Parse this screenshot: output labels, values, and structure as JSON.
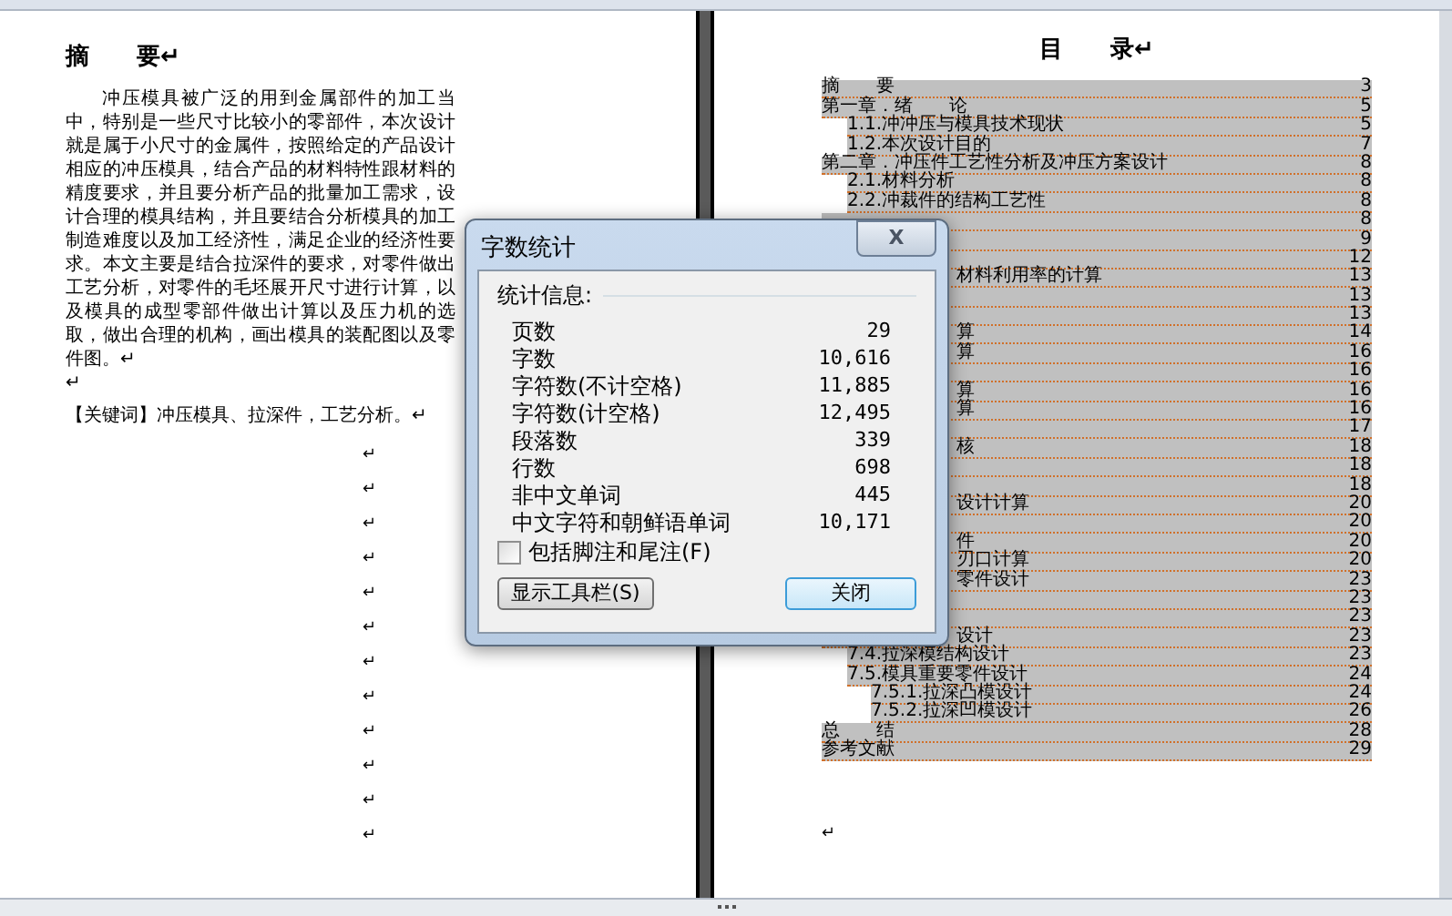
{
  "left_page": {
    "heading": "摘　　要↵",
    "abstract": "冲压模具被广泛的用到金属部件的加工当中，特别是一些尺寸比较小的零部件，本次设计就是属于小尺寸的金属件，按照给定的产品设计相应的冲压模具，结合产品的材料特性跟材料的精度要求，并且要分析产品的批量加工需求，设计合理的模具结构，并且要结合分析模具的加工制造难度以及加工经济性，满足企业的经济性要求。本文主要是结合拉深件的要求，对零件做出工艺分析，对零件的毛坯展开尺寸进行计算，以及模具的成型零部件做出计算以及压力机的选取，做出合理的机构，画出模具的装配图以及零件图。↵",
    "blank_mark": "↵",
    "keywords": "【关键词】冲压模具、拉深件，工艺分析。↵",
    "empty_paragraphs": [
      "↵",
      "↵",
      "↵",
      "↵",
      "↵",
      "↵",
      "↵",
      "↵",
      "↵",
      "↵",
      "↵",
      "↵"
    ]
  },
  "right_page": {
    "heading": "目　　录↵",
    "toc": [
      {
        "kind": "heading",
        "text": "摘　　要",
        "page": "3"
      },
      {
        "kind": "heading",
        "text": "第一章．绪　　论",
        "page": "5"
      },
      {
        "kind": "section",
        "text": "1.1.冲冲压与模具技术现状",
        "page": "5"
      },
      {
        "kind": "section",
        "text": "1.2.本次设计目的",
        "page": "7"
      },
      {
        "kind": "heading",
        "text": "第二章．冲压件工艺性分析及冲压方案设计",
        "page": "8"
      },
      {
        "kind": "section",
        "text": "2.1.材料分析",
        "page": "8"
      },
      {
        "kind": "section",
        "text": "2.2.冲裁件的结构工艺性",
        "page": "8"
      },
      {
        "kind": "clipped",
        "page": "8"
      },
      {
        "kind": "clipped",
        "page": "9"
      },
      {
        "kind": "clipped",
        "page": "12"
      },
      {
        "kind": "clipped",
        "text": "材料利用率的计算",
        "page": "13"
      },
      {
        "kind": "clipped",
        "page": "13"
      },
      {
        "kind": "clipped",
        "page": "13"
      },
      {
        "kind": "clipped",
        "text": "算",
        "page": "14"
      },
      {
        "kind": "clipped",
        "text": "算",
        "page": "16"
      },
      {
        "kind": "clipped",
        "page": "16"
      },
      {
        "kind": "clipped",
        "text": "算",
        "page": "16"
      },
      {
        "kind": "clipped",
        "text": "算",
        "page": "16"
      },
      {
        "kind": "clipped",
        "page": "17"
      },
      {
        "kind": "clipped",
        "text": "核",
        "page": "18"
      },
      {
        "kind": "clipped",
        "page": "18"
      },
      {
        "kind": "clipped",
        "page": "18"
      },
      {
        "kind": "clipped",
        "text": "设计计算",
        "page": "20"
      },
      {
        "kind": "clipped",
        "page": "20"
      },
      {
        "kind": "clipped",
        "text": "件",
        "page": "20"
      },
      {
        "kind": "clipped",
        "text": "刃口计算",
        "page": "20"
      },
      {
        "kind": "clipped",
        "text": "零件设计",
        "page": "23"
      },
      {
        "kind": "clipped",
        "page": "23"
      },
      {
        "kind": "clipped",
        "page": "23"
      },
      {
        "kind": "clipped",
        "text": "设计",
        "page": "23"
      },
      {
        "kind": "section",
        "text": "7.4.拉深模结构设计",
        "page": "23"
      },
      {
        "kind": "section",
        "text": "7.5.模具重要零件设计",
        "page": "24"
      },
      {
        "kind": "subsection",
        "text": "7.5.1.拉深凸模设计",
        "page": "24"
      },
      {
        "kind": "subsection",
        "text": "7.5.2.拉深凹模设计",
        "page": "26"
      },
      {
        "kind": "heading",
        "text": "总　　结",
        "page": "28"
      },
      {
        "kind": "heading",
        "text": "参考文献",
        "page": "29"
      }
    ],
    "end_mark": "↵"
  },
  "dialog": {
    "title": "字数统计",
    "close": "X",
    "group_label": "统计信息:",
    "stats": [
      {
        "label": "页数",
        "value": "29"
      },
      {
        "label": "字数",
        "value": "10,616"
      },
      {
        "label": "字符数(不计空格)",
        "value": "11,885"
      },
      {
        "label": "字符数(计空格)",
        "value": "12,495"
      },
      {
        "label": "段落数",
        "value": "339"
      },
      {
        "label": "行数",
        "value": "698"
      },
      {
        "label": "非中文单词",
        "value": "445"
      },
      {
        "label": "中文字符和朝鲜语单词",
        "value": "10,171"
      }
    ],
    "footnotes_checkbox": {
      "label": "包括脚注和尾注(F)",
      "checked": false
    },
    "buttons": [
      {
        "label": "显示工具栏(S)",
        "selected": false
      },
      {
        "label": "关闭",
        "selected": true
      }
    ]
  }
}
